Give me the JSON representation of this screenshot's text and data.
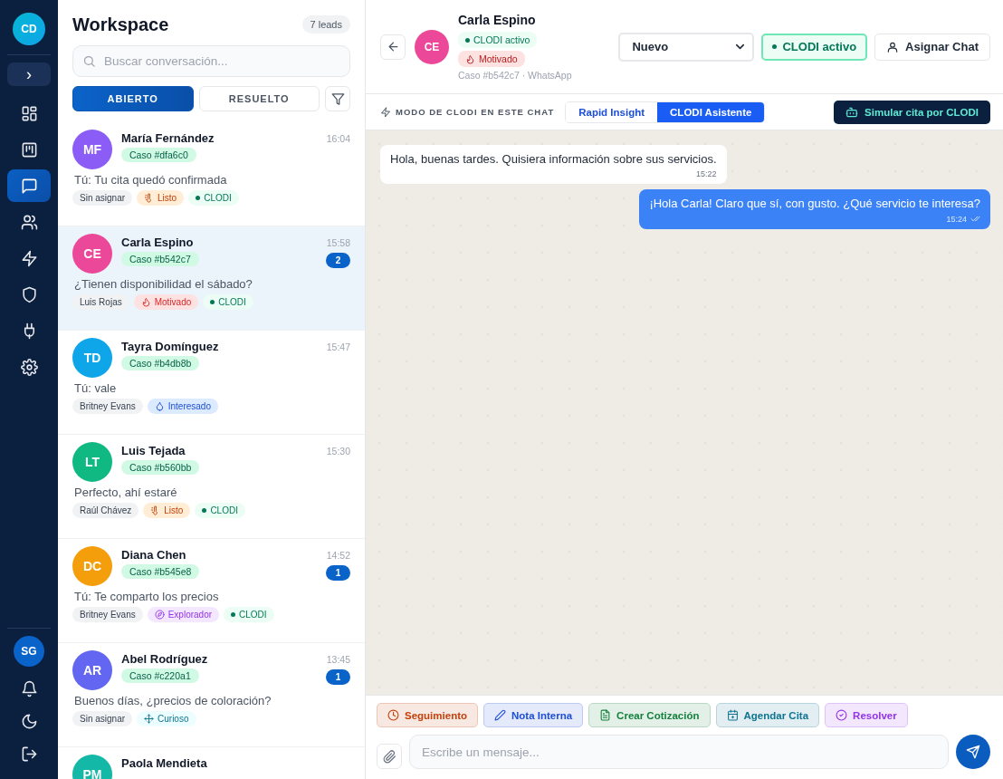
{
  "nav": {
    "avatar": "CD",
    "expand_icon": "›",
    "items": [
      {
        "kind": "grid",
        "selected": false
      },
      {
        "kind": "kanban",
        "selected": false
      },
      {
        "kind": "chat",
        "selected": true
      },
      {
        "kind": "users",
        "selected": false
      },
      {
        "kind": "zap",
        "selected": false
      },
      {
        "kind": "shield",
        "selected": false
      },
      {
        "kind": "plug",
        "selected": false
      },
      {
        "kind": "gear",
        "selected": false
      }
    ],
    "user_avatar": "SG",
    "bottom_items": [
      {
        "kind": "bell"
      },
      {
        "kind": "moon"
      },
      {
        "kind": "logout"
      }
    ]
  },
  "list": {
    "title": "Workspace",
    "count": "7 leads",
    "search": {
      "placeholder": "Buscar conversación..."
    },
    "tabs": [
      {
        "label": "ABIERTO",
        "selected": true
      },
      {
        "label": "RESUELTO",
        "selected": false
      }
    ],
    "conversations": [
      {
        "initials": "MF",
        "color": "#8b5cf6",
        "name": "María Fernández",
        "case": "Caso #dfa6c0",
        "time": "16:04",
        "preview": "Tú: Tu cita quedó confirmada",
        "selected": false,
        "tags": [
          {
            "kind": "assignee",
            "label": "Sin asignar"
          },
          {
            "kind": "thermometer",
            "label": "Listo",
            "color": "#ffedd5"
          },
          {
            "kind": "clodi",
            "label": "CLODI"
          }
        ]
      },
      {
        "initials": "CE",
        "color": "#ec4899",
        "name": "Carla Espino",
        "case": "Caso #b542c7",
        "time": "15:58",
        "unread": "2",
        "preview": "¿Tienen disponibilidad el sábado?",
        "selected": true,
        "tags": [
          {
            "kind": "assignee",
            "label": "Luis Rojas"
          },
          {
            "kind": "flame",
            "label": "Motivado",
            "color": "#fee2e2"
          },
          {
            "kind": "clodi",
            "label": "CLODI"
          }
        ]
      },
      {
        "initials": "TD",
        "color": "#0ea5e9",
        "name": "Tayra Domínguez",
        "case": "Caso #b4db8b",
        "time": "15:47",
        "preview": "Tú: vale",
        "selected": false,
        "tags": [
          {
            "kind": "assignee",
            "label": "Britney Evans"
          },
          {
            "kind": "droplet",
            "label": "Interesado",
            "color": "#dbeafe"
          }
        ]
      },
      {
        "initials": "LT",
        "color": "#10b981",
        "name": "Luis Tejada",
        "case": "Caso #b560bb",
        "time": "15:30",
        "preview": "Perfecto, ahí estaré",
        "selected": false,
        "tags": [
          {
            "kind": "assignee",
            "label": "Raúl Chávez"
          },
          {
            "kind": "thermometer",
            "label": "Listo",
            "color": "#ffedd5"
          },
          {
            "kind": "clodi",
            "label": "CLODI"
          }
        ]
      },
      {
        "initials": "DC",
        "color": "#f59e0b",
        "name": "Diana Chen",
        "case": "Caso #b545e8",
        "time": "14:52",
        "unread": "1",
        "preview": "Tú: Te comparto los precios",
        "selected": false,
        "tags": [
          {
            "kind": "assignee",
            "label": "Britney Evans"
          },
          {
            "kind": "compass",
            "label": "Explorador",
            "color": "#f3e8ff"
          },
          {
            "kind": "clodi",
            "label": "CLODI"
          }
        ]
      },
      {
        "initials": "AR",
        "color": "#6366f1",
        "name": "Abel Rodríguez",
        "case": "Caso #c220a1",
        "time": "13:45",
        "unread": "1",
        "preview": "Buenos días, ¿precios de coloración?",
        "selected": false,
        "tags": [
          {
            "kind": "assignee",
            "label": "Sin asignar"
          },
          {
            "kind": "move",
            "label": "Curioso",
            "color": "#ecfeff"
          }
        ]
      },
      {
        "initials": "PM",
        "color": "#14b8a6",
        "name": "Paola Mendieta",
        "selected": false
      }
    ]
  },
  "chat": {
    "initials": "CE",
    "color": "#ec4899",
    "name": "Carla Espino",
    "status_badge": "CLODI activo",
    "mood_badge": "Motivado",
    "meta": "Caso #b542c7 · WhatsApp",
    "stage_select": "Nuevo",
    "clodi_button": "CLODI activo",
    "assign_button": "Asignar Chat",
    "mode_label": "MODO DE CLODI EN ESTE CHAT",
    "modes": [
      {
        "label": "Rapid Insight",
        "selected": false
      },
      {
        "label": "CLODI Asistente",
        "selected": true
      }
    ],
    "simulate_button": "Simular cita por CLODI",
    "messages": [
      {
        "kind": "incoming",
        "text": "Hola, buenas tardes. Quisiera información sobre sus servicios.",
        "time": "15:22"
      },
      {
        "kind": "outgoing",
        "text": "¡Hola Carla! Claro que sí, con gusto. ¿Qué servicio te interesa?",
        "time": "15:24",
        "read": true
      }
    ],
    "actions": [
      {
        "kind": "clock",
        "label": "Seguimiento",
        "color": "#c2410c"
      },
      {
        "kind": "pencil",
        "label": "Nota Interna",
        "color": "#1d4ed8"
      },
      {
        "kind": "file",
        "label": "Crear Cotización",
        "color": "#15803d"
      },
      {
        "kind": "calendar",
        "label": "Agendar Cita",
        "color": "#0e7490"
      },
      {
        "kind": "check",
        "label": "Resolver",
        "color": "#9333ea"
      }
    ],
    "composer": {
      "placeholder": "Escribe un mensaje..."
    }
  }
}
